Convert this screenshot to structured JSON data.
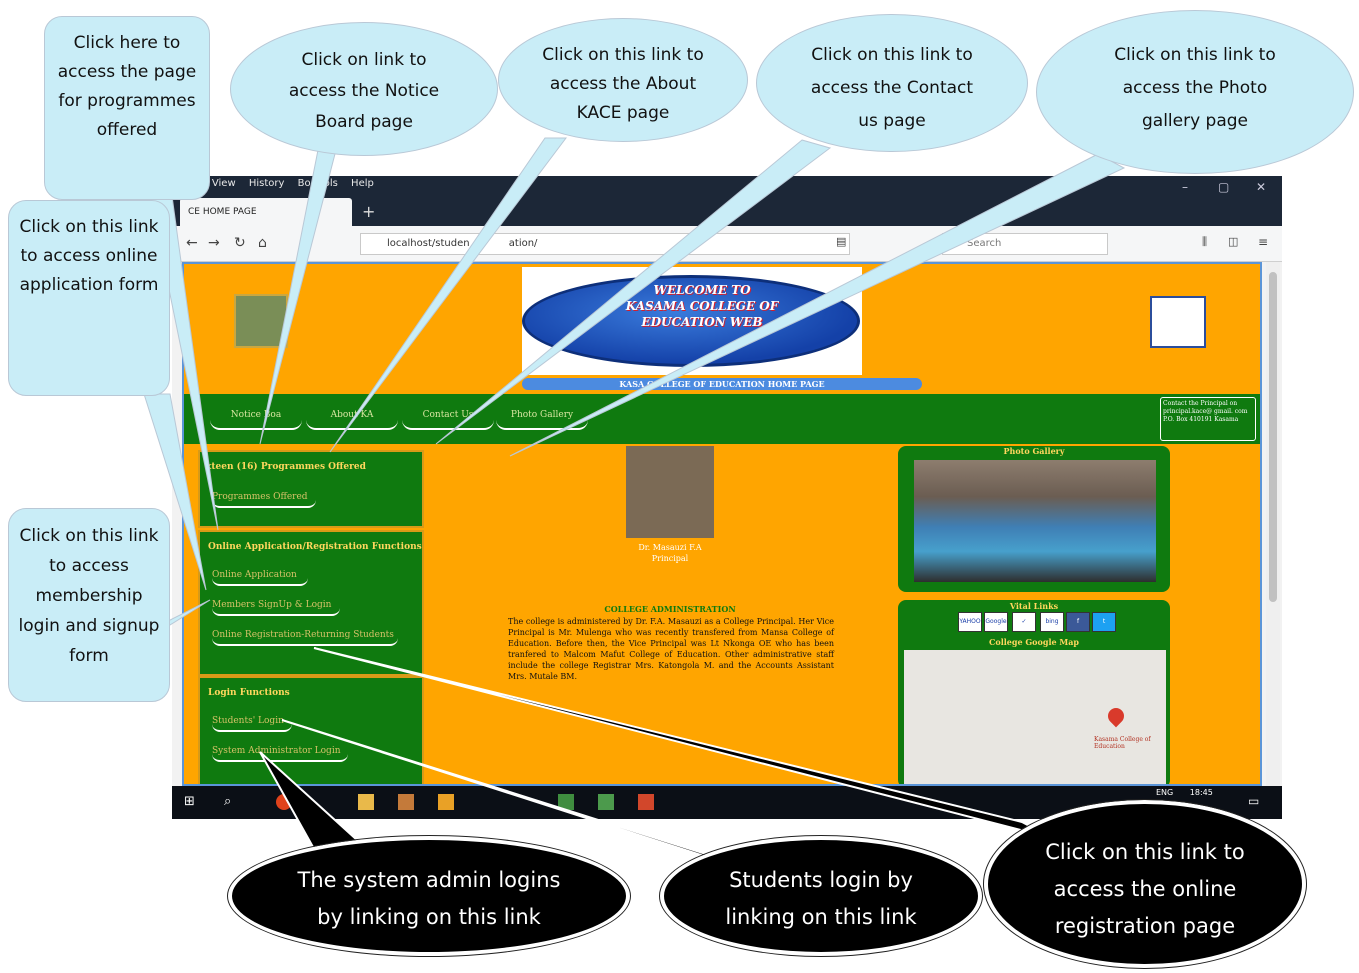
{
  "browser": {
    "menu": [
      "View",
      "History",
      "Bo",
      "ols",
      "Help"
    ],
    "menu_prefix": "it",
    "tab_title": "CE HOME PAGE",
    "new_tab": "+",
    "url": "localhost/studen",
    "url_tail": "ation/",
    "search_placeholder": "Search",
    "window_controls": [
      "–",
      "▢",
      "✕"
    ]
  },
  "page": {
    "banner_text": "WELCOME TO KASAMA COLLEGE OF EDUCATION WEB",
    "home_strip": "KASA    COLLEGE OF EDUCATION HOME PAGE",
    "nav_links": [
      "Notice Boa",
      "About KA",
      "Contact Us",
      "Photo Gallery"
    ],
    "contact_box": "Contact the Principal on principal.kace@ gmail. com P.O. Box 410191 Kasama",
    "panels": {
      "programmes": {
        "title": "xteen (16) Programmes Offered",
        "link": "Programmes Offered"
      },
      "online": {
        "title": "Online Application/Registration Functions",
        "links": [
          "Online Application",
          "Members SignUp & Login",
          "Online Registration-Returning Students"
        ]
      },
      "login": {
        "title": "Login Functions",
        "links": [
          "Students' Login",
          "System Administrator Login"
        ]
      }
    },
    "principal_caption_1": "Dr. Masauzi F.A",
    "principal_caption_2": "Principal",
    "admin_title": "COLLEGE ADMINISTRATION",
    "admin_body": "The college is administered by Dr. F.A. Masauzi as a College Principal. Her Vice Principal is Mr. Mulenga who was recently transfered from Mansa College of Education. Before then, the Vice Principal was Lt Nkonga OE who has been tranfered to Malcom Mafut College of Education. Other administrative staff include the college Registrar Mrs. Katongola M. and the Accounts Assistant Mrs. Mutale BM.",
    "gallery_title": "Photo Gallery",
    "vital_title": "Vital Links",
    "vital_icons": [
      "YAHOO",
      "Google",
      "✓",
      "bing",
      "f",
      "t"
    ],
    "map_title": "College Google Map",
    "map_label": "Kasama College of Education"
  },
  "taskbar": {
    "lang": "ENG",
    "time": "18:45"
  },
  "callouts": {
    "programmes": "Click here to access the page for programmes offered",
    "notice": "Click on link to access the Notice Board page",
    "about": "Click on this link to access the About KACE page",
    "contact": "Click on this link to access the Contact us page",
    "gallery": "Click on this link to access the Photo gallery page",
    "application": "Click on this link to access online application form",
    "membership": "Click on this link to access membership login and signup form",
    "sysadmin": "The system admin logins by linking on this link",
    "students": "Students login by linking on this link",
    "registration": "Click on this link to access the online registration page"
  },
  "colors": {
    "page_bg": "#ffa500",
    "panel_green": "#0f7a0f",
    "callout_blue": "#c9edf7",
    "callout_dark": "#000000"
  }
}
